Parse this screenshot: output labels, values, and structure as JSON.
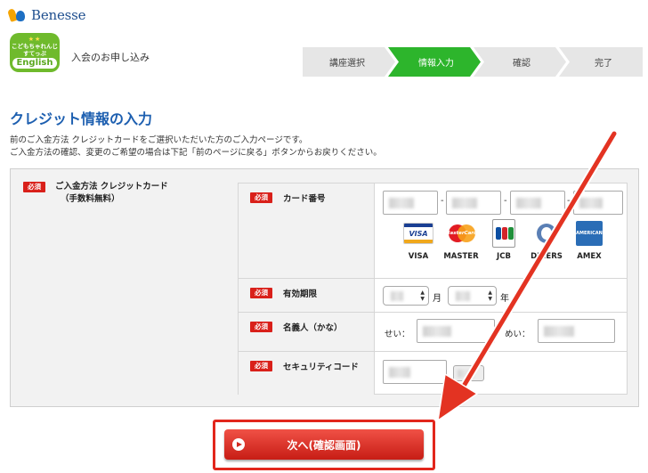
{
  "header": {
    "brand_name": "Benesse",
    "course_logo": {
      "line1": "こどもちゃれんじ",
      "line2": "すてっぷ",
      "main": "English"
    },
    "apply_title": "入会のお申し込み"
  },
  "steps": [
    {
      "label": "講座選択",
      "active": false
    },
    {
      "label": "情報入力",
      "active": true
    },
    {
      "label": "確認",
      "active": false
    },
    {
      "label": "完了",
      "active": false
    }
  ],
  "page": {
    "title": "クレジット情報の入力",
    "intro_line1": "前のご入金方法 クレジットカードをご選択いただいた方のご入力ページです。",
    "intro_line2": "ご入金方法の確認、変更のご希望の場合は下記「前のページに戻る」ボタンからお戻りください。"
  },
  "form": {
    "required_label": "必須",
    "payment_method_line1": "ご入金方法 クレジットカード",
    "payment_method_line2": "（手数料無料）",
    "card_number_label": "カード番号",
    "card_separator": "-",
    "card_brands": [
      {
        "name": "VISA",
        "icon": "visa-icon"
      },
      {
        "name": "MASTER",
        "icon": "mastercard-icon"
      },
      {
        "name": "JCB",
        "icon": "jcb-icon"
      },
      {
        "name": "DINERS",
        "icon": "diners-icon"
      },
      {
        "name": "AMEX",
        "icon": "amex-icon"
      }
    ],
    "expiry_label": "有効期限",
    "month_unit": "月",
    "year_unit": "年",
    "holder_label": "名義人（かな）",
    "sei_label": "せい：",
    "mei_label": "めい：",
    "security_label": "セキュリティコード"
  },
  "submit": {
    "label": "次へ(確認画面)"
  },
  "colors": {
    "active_step": "#2db52c",
    "inactive_step": "#e6e6e6",
    "title": "#1d5fb0",
    "required": "#d9201a",
    "submit": "#d9261c",
    "annotation_arrow": "#e33322"
  }
}
